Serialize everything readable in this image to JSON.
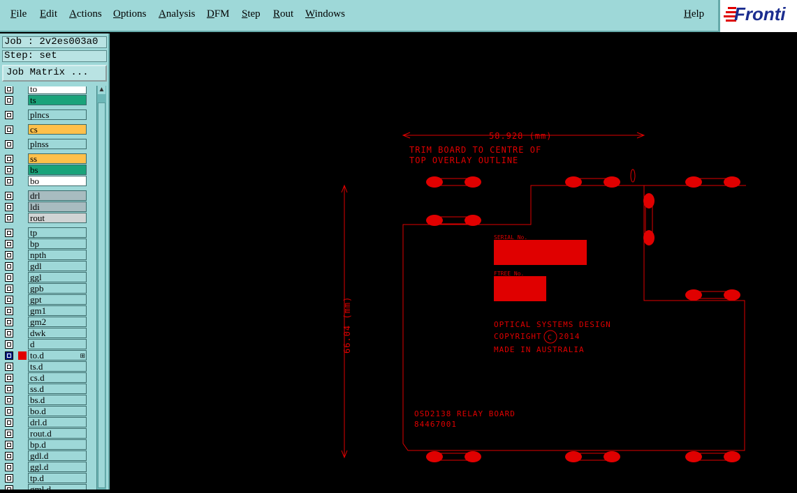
{
  "menu": {
    "file": "File",
    "edit": "Edit",
    "actions": "Actions",
    "options": "Options",
    "analysis": "Analysis",
    "dfm": "DFM",
    "step": "Step",
    "rout": "Rout",
    "windows": "Windows",
    "help": "Help"
  },
  "logo": "Fronti",
  "job_label": "Job : 2v2es003a0",
  "step_label": "Step: set",
  "job_matrix_button": "Job Matrix ...",
  "layers": [
    {
      "name": "to",
      "color": "#ffffff"
    },
    {
      "name": "ts",
      "color": "#1aa37a"
    },
    {
      "name": "plncs",
      "color": "#9ed8d8"
    },
    {
      "name": "cs",
      "color": "#ffc04a"
    },
    {
      "name": "plnss",
      "color": "#9ed8d8"
    },
    {
      "name": "ss",
      "color": "#ffc04a"
    },
    {
      "name": "bs",
      "color": "#1aa37a"
    },
    {
      "name": "bo",
      "color": "#ffffff"
    },
    {
      "name": "drl",
      "color": "#a8bcc0"
    },
    {
      "name": "ldi",
      "color": "#a8bcc0"
    },
    {
      "name": "rout",
      "color": "#d0d4d4"
    },
    {
      "name": "tp",
      "color": "#9ed8d8"
    },
    {
      "name": "bp",
      "color": "#9ed8d8"
    },
    {
      "name": "npth",
      "color": "#9ed8d8"
    },
    {
      "name": "gdl",
      "color": "#9ed8d8"
    },
    {
      "name": "ggl",
      "color": "#9ed8d8"
    },
    {
      "name": "gpb",
      "color": "#9ed8d8"
    },
    {
      "name": "gpt",
      "color": "#9ed8d8"
    },
    {
      "name": "gm1",
      "color": "#9ed8d8"
    },
    {
      "name": "gm2",
      "color": "#9ed8d8"
    },
    {
      "name": "dwk",
      "color": "#9ed8d8"
    },
    {
      "name": "d",
      "color": "#9ed8d8"
    },
    {
      "name": "to.d",
      "color": "#9ed8d8",
      "active": true
    },
    {
      "name": "ts.d",
      "color": "#9ed8d8"
    },
    {
      "name": "cs.d",
      "color": "#9ed8d8"
    },
    {
      "name": "ss.d",
      "color": "#9ed8d8"
    },
    {
      "name": "bs.d",
      "color": "#9ed8d8"
    },
    {
      "name": "bo.d",
      "color": "#9ed8d8"
    },
    {
      "name": "drl.d",
      "color": "#9ed8d8"
    },
    {
      "name": "rout.d",
      "color": "#9ed8d8"
    },
    {
      "name": "bp.d",
      "color": "#9ed8d8"
    },
    {
      "name": "gdl.d",
      "color": "#9ed8d8"
    },
    {
      "name": "ggl.d",
      "color": "#9ed8d8"
    },
    {
      "name": "tp.d",
      "color": "#9ed8d8"
    },
    {
      "name": "gml.d",
      "color": "#9ed8d8"
    }
  ],
  "drawing": {
    "line_color": "#e00000",
    "width_dimension": "58.928 (mm)",
    "height_dimension": "66.04 (mm)",
    "note_line1": "TRIM BOARD TO CENTRE OF",
    "note_line2": "TOP OVERLAY OUTLINE",
    "serial_label": "SERIAL No.",
    "ftree_label": "FTREE No.",
    "company_line1": "OPTICAL SYSTEMS DESIGN",
    "company_line2": "COPYRIGHT",
    "copyright_symbol": "C",
    "company_year": "2014",
    "company_line3": "MADE IN AUSTRALIA",
    "board_name": "OSD2138 RELAY BOARD",
    "board_number": "84467001"
  }
}
